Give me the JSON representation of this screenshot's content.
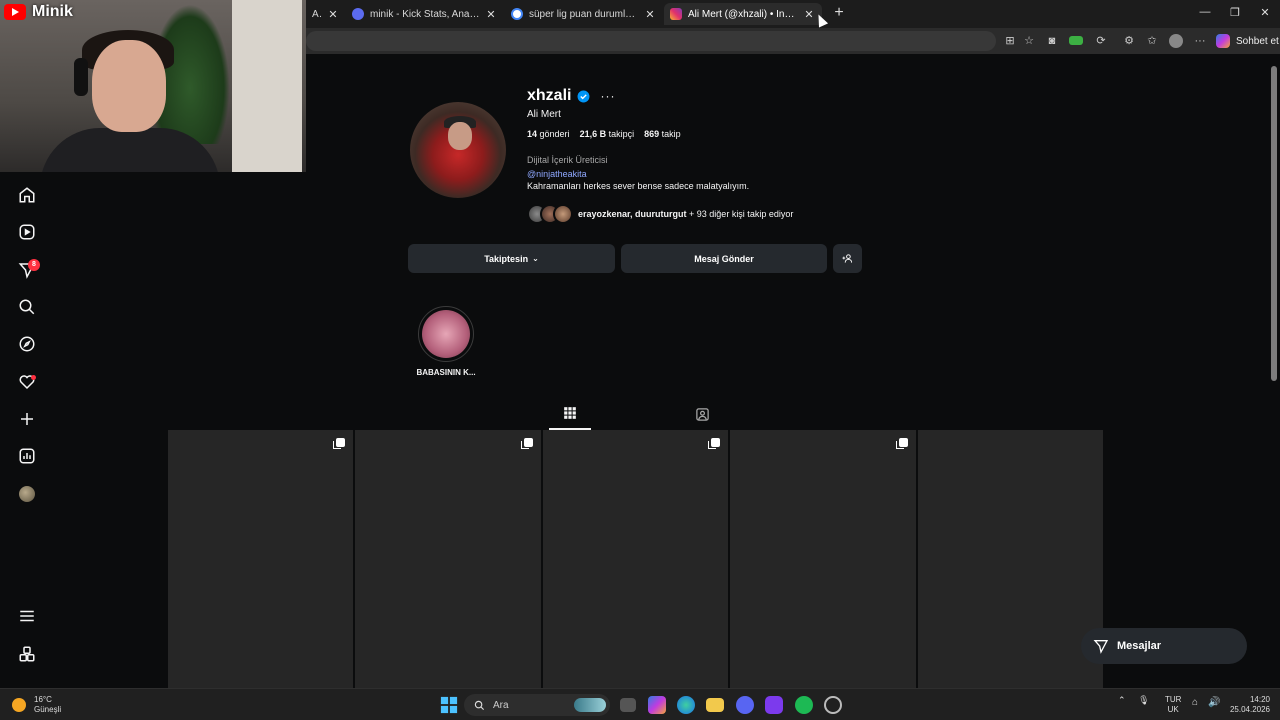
{
  "browser": {
    "tabs": [
      {
        "label": "AM /K",
        "active": false
      },
      {
        "label": "minik - Kick Stats, Analytics and C",
        "active": false
      },
      {
        "label": "süper lig puan durumları - Google",
        "active": false
      },
      {
        "label": "Ali Mert (@xhzali) • Instagram foto",
        "active": true
      }
    ],
    "copilot_label": "Sohbet et"
  },
  "webcam": {
    "channel_name": "Minik"
  },
  "nav": {
    "notification_count": "8"
  },
  "profile": {
    "username": "xhzali",
    "full_name": "Ali Mert",
    "posts_count": "14",
    "posts_label": "gönderi",
    "followers_count": "21,6 B",
    "followers_label": "takipçi",
    "following_count": "869",
    "following_label": "takip",
    "category": "Dijital İçerik Üreticisi",
    "mention": "@ninjatheakita",
    "bio": "Kahramanları herkes sever bense sadece malatyalıyım.",
    "followed_by_names": "erayozkenar, duuruturgut",
    "followed_by_rest": " + 93 diğer kişi takip ediyor"
  },
  "actions": {
    "following_label": "Takiptesin",
    "message_label": "Mesaj Gönder"
  },
  "highlights": [
    {
      "label": "BABASININ K..."
    }
  ],
  "posts_count_visible": 5,
  "messages_pill": {
    "label": "Mesajlar"
  },
  "taskbar": {
    "weather_temp": "16°C",
    "weather_desc": "Güneşli",
    "search_placeholder": "Ara",
    "lang_1": "TUR",
    "lang_2": "UK",
    "time": "14:20",
    "date": "25.04.2026"
  },
  "colors": {
    "accent_blue": "#0095f6",
    "badge_red": "#ff3040",
    "mention": "#8fa8ff"
  }
}
